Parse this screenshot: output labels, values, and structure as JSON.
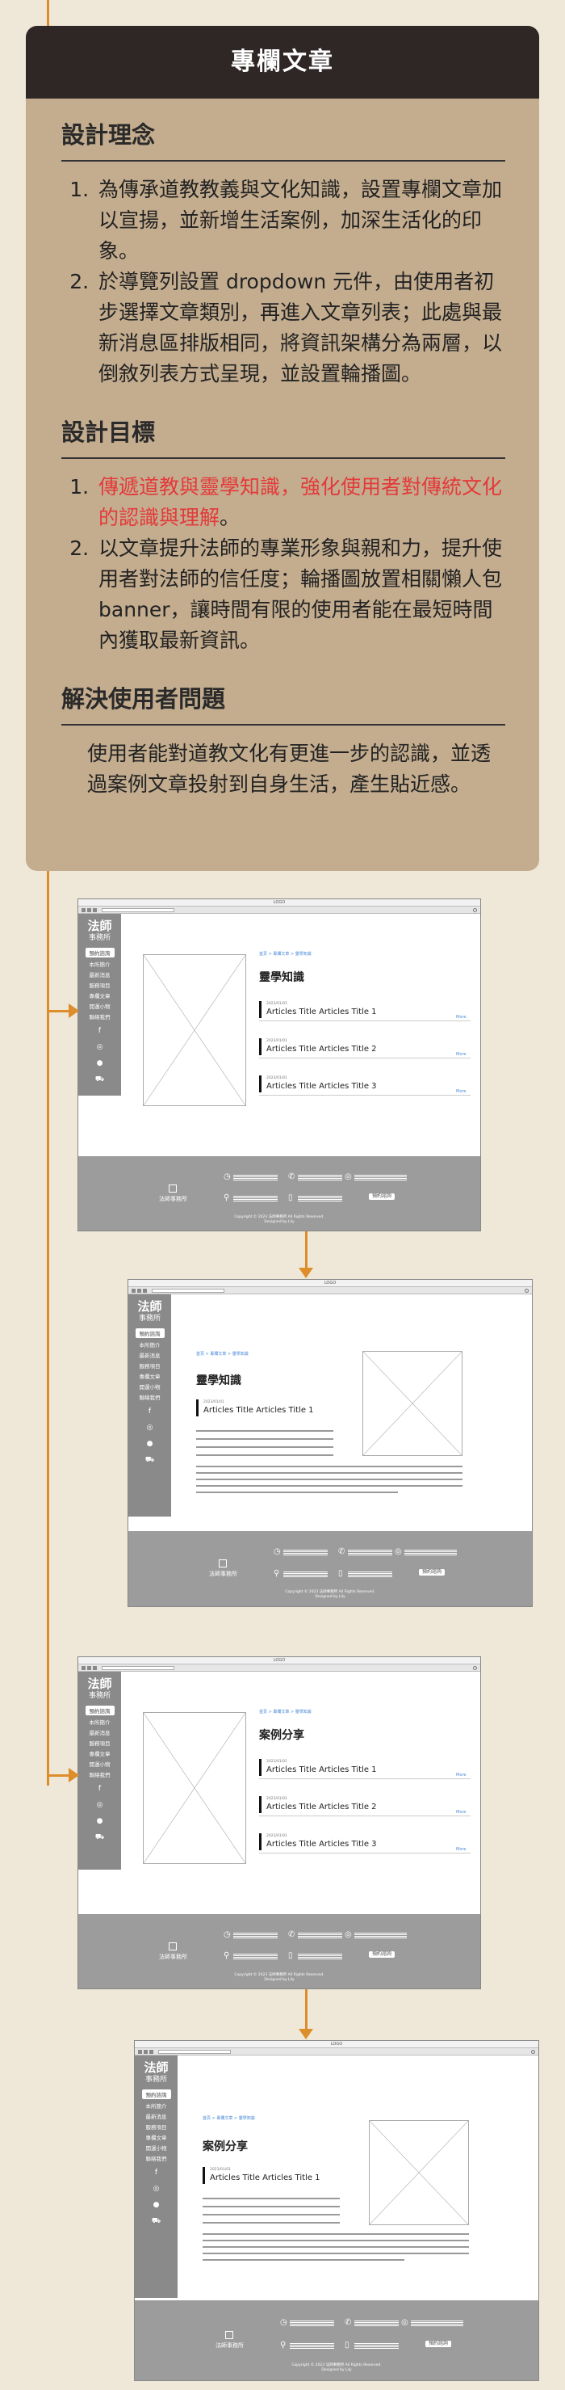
{
  "card": {
    "title": "專欄文章",
    "sections": {
      "concept": {
        "title": "設計理念",
        "items": [
          "為傳承道教教義與文化知識，設置專欄文章加以宣揚，並新增生活案例，加深生活化的印象。",
          "於導覽列設置 dropdown 元件，由使用者初步選擇文章類別，再進入文章列表；此處與最新消息區排版相同，將資訊架構分為兩層，以倒敘列表方式呈現，並設置輪播圖。"
        ]
      },
      "goals": {
        "title": "設計目標",
        "item1_highlight": "傳遞道教與靈學知識，強化使用者對傳統文化的認識與理解",
        "item1_tail": "。",
        "item2": "以文章提升法師的專業形象與親和力，提升使用者對法師的信任度；輪播圖放置相關懶人包 banner，讓時間有限的使用者能在最短時間內獲取最新資訊。"
      },
      "problem": {
        "title": "解決使用者問題",
        "text": "使用者能對道教文化有更進一步的認識，並透過案例文章投射到自身生活，產生貼近感。"
      }
    }
  },
  "wireframe": {
    "window_title": "LOGO",
    "logo_big": "法師",
    "logo_small": "事務所",
    "nav_button": "預約諮詢",
    "nav_items": [
      "本所簡介",
      "最新消息",
      "服務項目",
      "專欄文章",
      "開運小物",
      "聯絡我們"
    ],
    "nav_icons": [
      "facebook-icon",
      "instagram-icon",
      "user-icon",
      "cart-icon"
    ],
    "breadcrumb": "首頁 > 專欄文章 > 靈學知識",
    "article_date": "2023/01/01",
    "more_label": "More",
    "footer_logo_text": "法師事務所",
    "footer_button": "預約諮詢",
    "copyright_line1": "Copyright © 2023 法師事務所 All Rights Reserved.",
    "copyright_line2": "Designed by Lily"
  },
  "wireframes": [
    {
      "name": "knowledge-list",
      "heading": "靈學知識",
      "articles": [
        "Articles Title Articles Title 1",
        "Articles Title Articles Title 2",
        "Articles Title Articles Title 3"
      ]
    },
    {
      "name": "knowledge-detail",
      "heading": "靈學知識",
      "articles": [
        "Articles Title Articles Title 1"
      ]
    },
    {
      "name": "case-list",
      "heading": "案例分享",
      "articles": [
        "Articles Title Articles Title 1",
        "Articles Title Articles Title 2",
        "Articles Title Articles Title 3"
      ]
    },
    {
      "name": "case-detail",
      "heading": "案例分享",
      "articles": [
        "Articles Title Articles Title 1"
      ]
    }
  ],
  "colors": {
    "background": "#efe7d8",
    "card": "#c4ad8f",
    "header": "#2e2725",
    "accent": "#dd8e2a",
    "highlight": "#e33a3a"
  }
}
